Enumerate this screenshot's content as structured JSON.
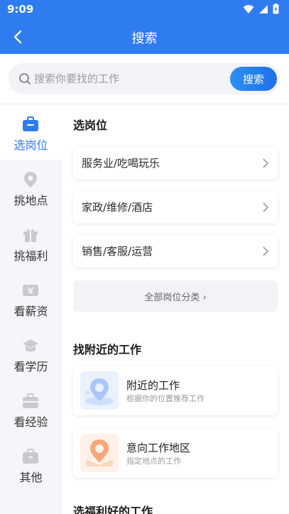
{
  "status_bar": {
    "time": "9:09"
  },
  "header": {
    "title": "搜索"
  },
  "search": {
    "placeholder": "搜索你要找的工作",
    "button_label": "搜索"
  },
  "sidebar": {
    "items": [
      {
        "label": "选岗位",
        "icon": "briefcase-icon",
        "active": true
      },
      {
        "label": "挑地点",
        "icon": "location-pin-icon"
      },
      {
        "label": "挑福利",
        "icon": "gift-icon"
      },
      {
        "label": "看薪资",
        "icon": "yen-icon"
      },
      {
        "label": "看学历",
        "icon": "graduation-cap-icon"
      },
      {
        "label": "看经验",
        "icon": "toolbox-icon"
      },
      {
        "label": "其他",
        "icon": "bag-icon"
      }
    ]
  },
  "main": {
    "section_positions": {
      "title": "选岗位"
    },
    "categories": [
      {
        "label": "服务业/吃喝玩乐"
      },
      {
        "label": "家政/维修/酒店"
      },
      {
        "label": "销售/客服/运营"
      }
    ],
    "all_categories_label": "全部岗位分类 ›",
    "section_nearby": {
      "title": "找附近的工作"
    },
    "nearby": [
      {
        "title": "附近的工作",
        "subtitle": "根据你的位置推荐工作"
      },
      {
        "title": "意向工作地区",
        "subtitle": "指定地点的工作"
      }
    ],
    "section_benefits": {
      "title": "选福利好的工作"
    }
  },
  "colors": {
    "primary": "#2f7bf0",
    "sidebar_bg": "#f5f6f9",
    "search_bg": "#f2f3f7"
  }
}
